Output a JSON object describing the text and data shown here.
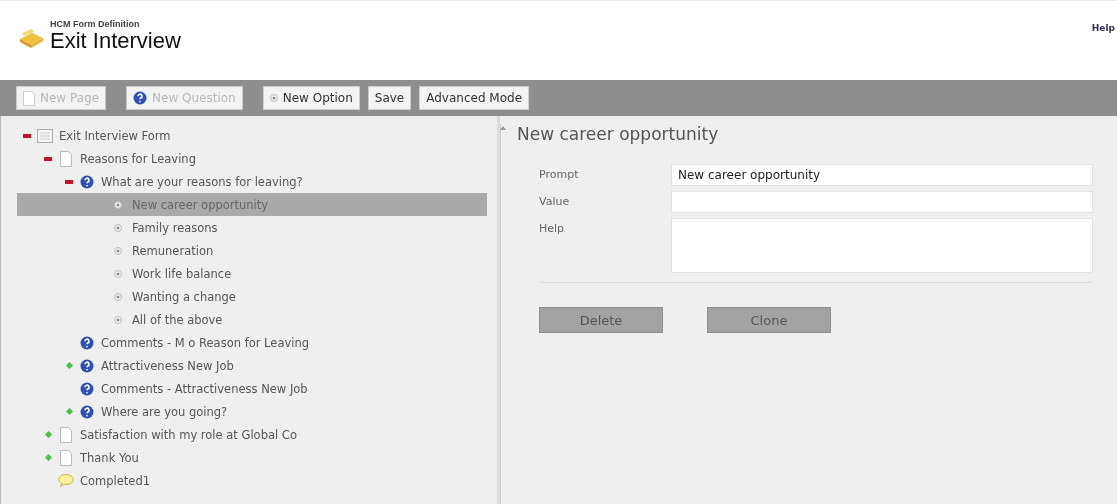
{
  "header": {
    "subtitle": "HCM Form Definition",
    "title": "Exit Interview",
    "help_link": "Help"
  },
  "toolbar": [
    {
      "label": "New Page",
      "kind": "page",
      "disabled": true
    },
    {
      "label": "New Question",
      "kind": "question",
      "disabled": true
    },
    {
      "label": "New Option",
      "kind": "option",
      "disabled": false
    },
    {
      "label": "Save",
      "kind": "plain",
      "disabled": false
    },
    {
      "label": "Advanced Mode",
      "kind": "plain",
      "disabled": false
    }
  ],
  "tree": [
    {
      "label": "Exit Interview Form",
      "kind": "form",
      "expanded": true,
      "selected": false,
      "children": [
        {
          "label": "Reasons for Leaving",
          "kind": "page",
          "expanded": true,
          "selected": false,
          "children": [
            {
              "label": "What are your reasons for leaving?",
              "kind": "question",
              "expanded": true,
              "selected": false,
              "children": [
                {
                  "label": "New career opportunity",
                  "kind": "option",
                  "selected": true
                },
                {
                  "label": "Family reasons",
                  "kind": "option",
                  "selected": false
                },
                {
                  "label": "Remuneration",
                  "kind": "option",
                  "selected": false
                },
                {
                  "label": "Work life balance",
                  "kind": "option",
                  "selected": false
                },
                {
                  "label": "Wanting a change",
                  "kind": "option",
                  "selected": false
                },
                {
                  "label": "All of the above",
                  "kind": "option",
                  "selected": false
                }
              ]
            },
            {
              "label": "Comments - M  o Reason for Leaving",
              "kind": "question",
              "selected": false
            },
            {
              "label": "Attractiveness New Job",
              "kind": "question",
              "expanded": false,
              "selected": false
            },
            {
              "label": "Comments - Attractiveness New Job",
              "kind": "question",
              "selected": false
            },
            {
              "label": "Where are you going?",
              "kind": "question",
              "expanded": false,
              "selected": false
            }
          ]
        },
        {
          "label": "Satisfaction with my role at Global Co",
          "kind": "page",
          "expanded": false,
          "selected": false
        },
        {
          "label": "Thank You",
          "kind": "page",
          "expanded": false,
          "selected": false
        },
        {
          "label": "Completed1",
          "kind": "end",
          "selected": false
        }
      ]
    }
  ],
  "detail": {
    "title": "New career opportunity",
    "fields": [
      {
        "label": "Prompt",
        "value": "New career opportunity",
        "kind": "line"
      },
      {
        "label": "Value",
        "kind": "line"
      },
      {
        "label": "Help",
        "kind": "area"
      }
    ],
    "buttons": [
      "Delete",
      "Clone"
    ]
  }
}
